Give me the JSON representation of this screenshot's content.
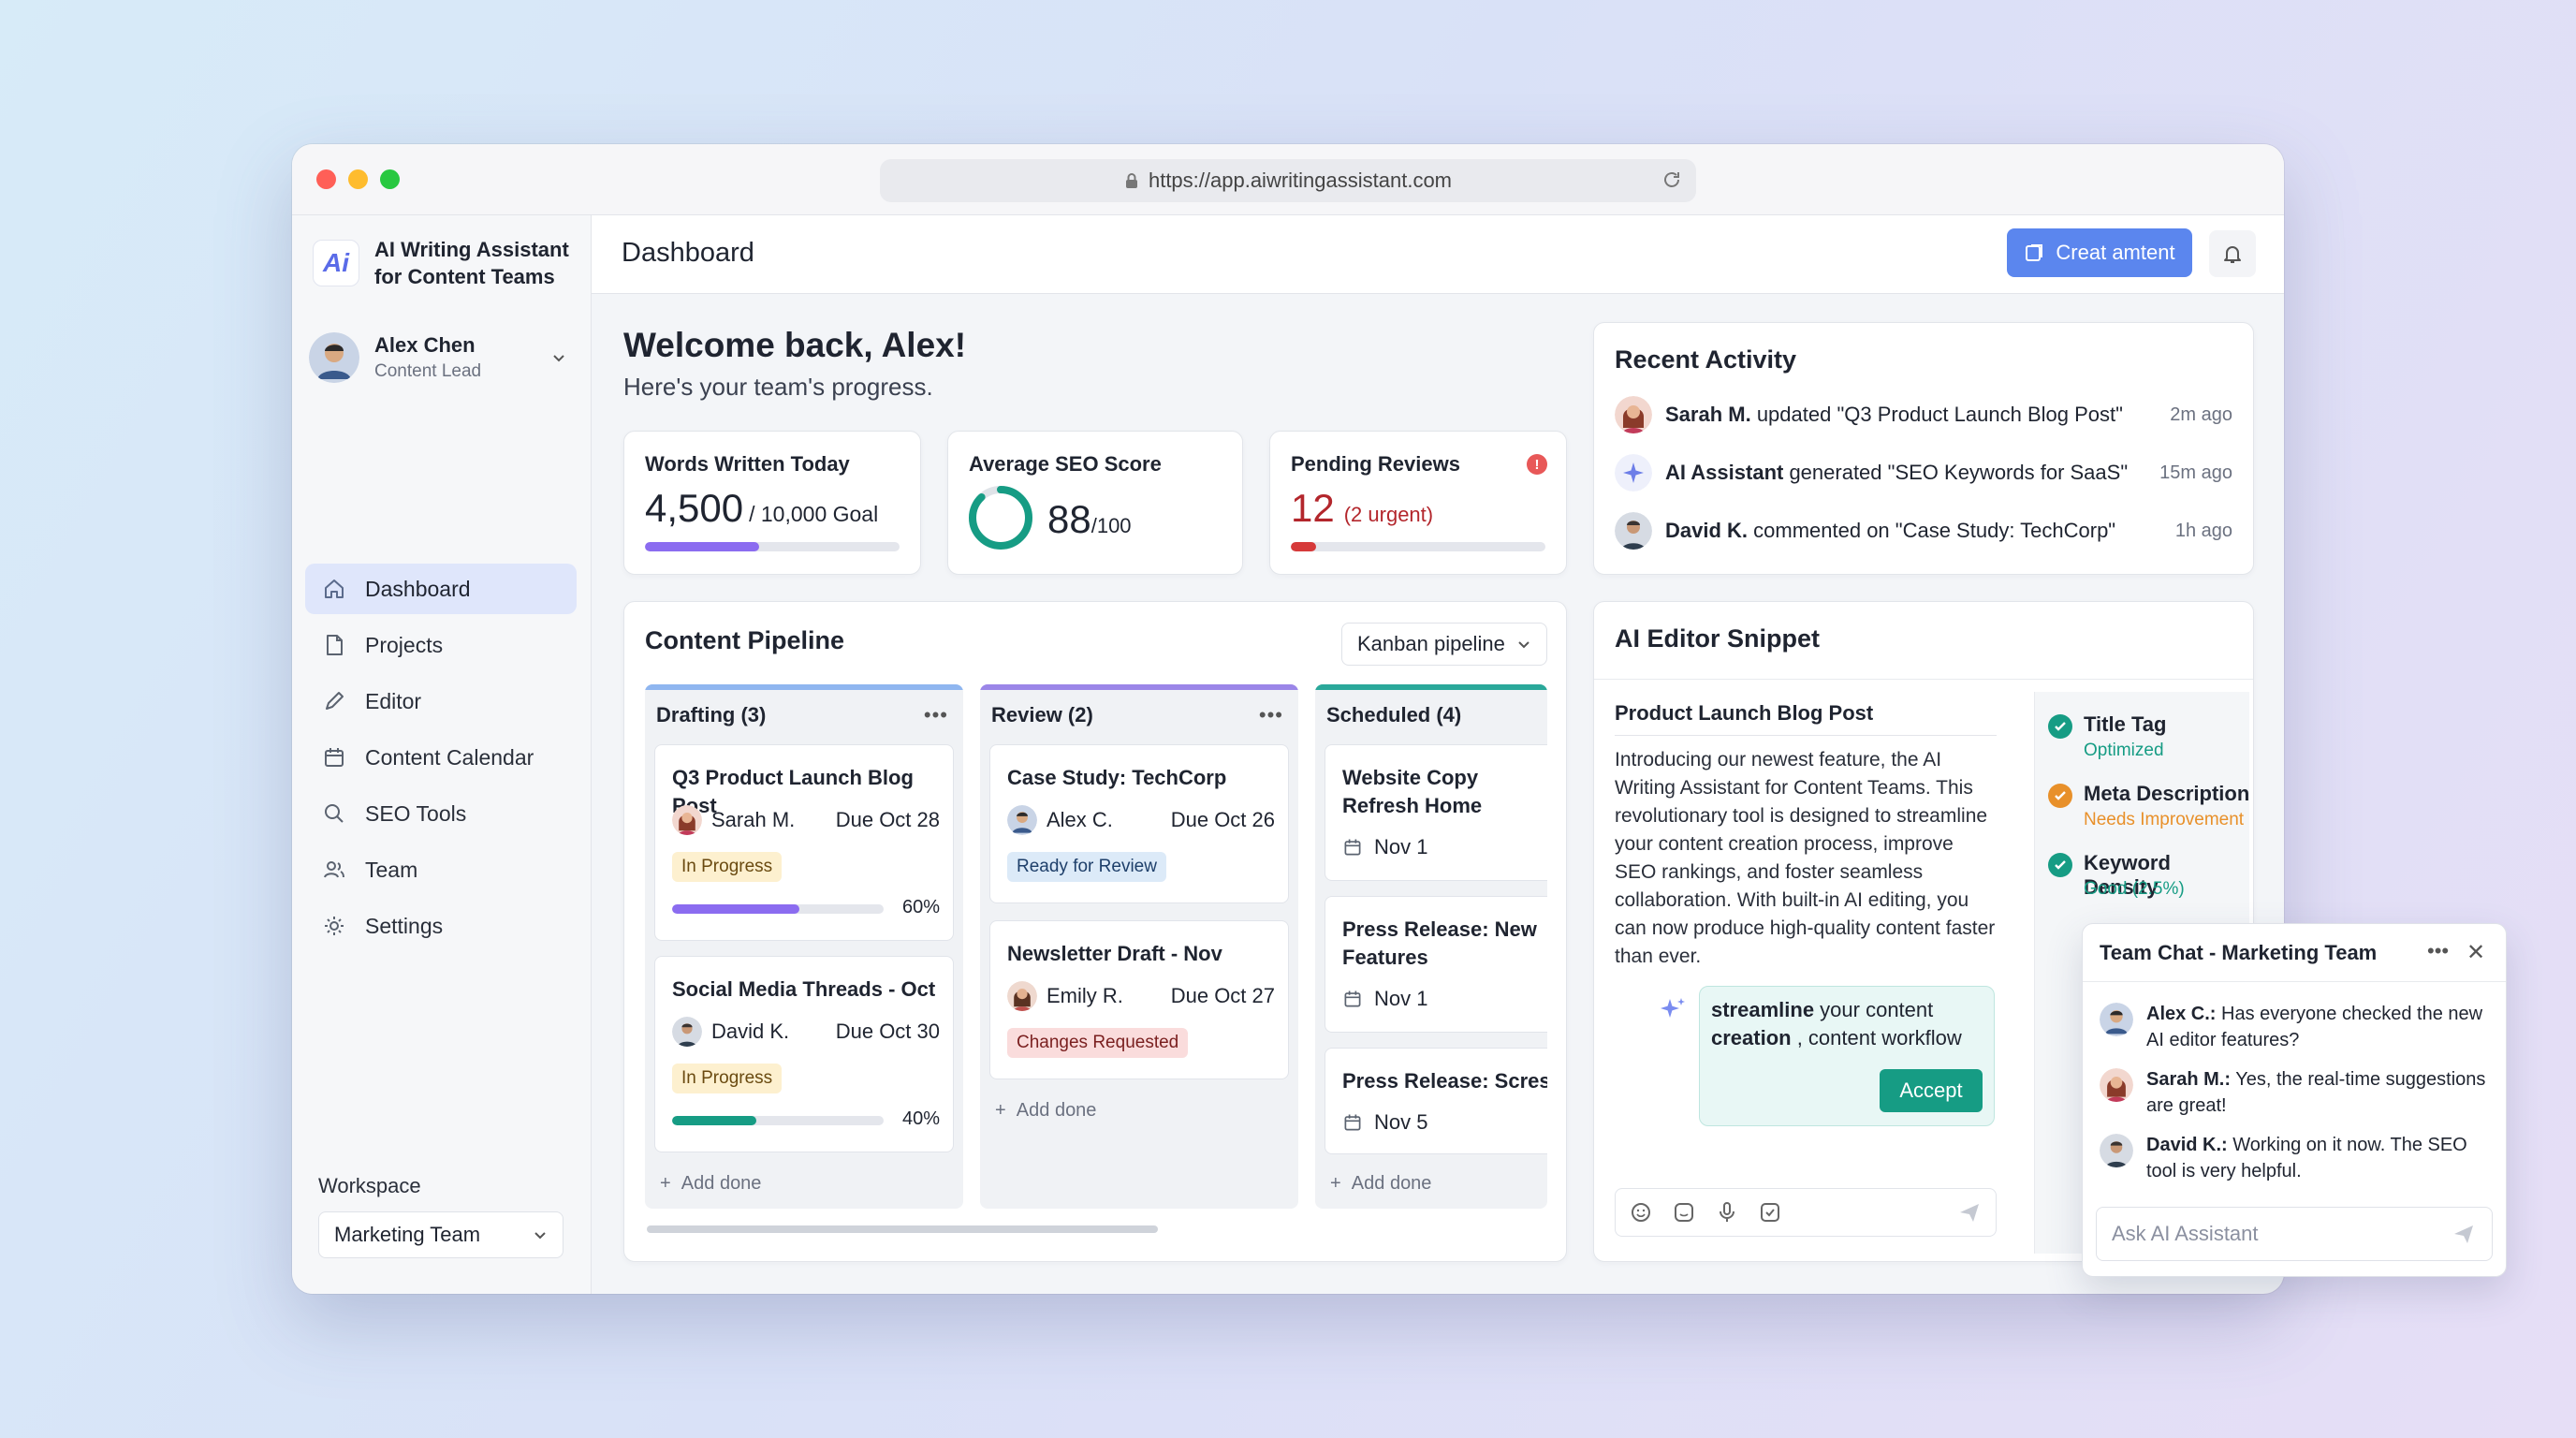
{
  "browser": {
    "url": "https://app.aiwritingassistant.com"
  },
  "brand": {
    "logo_text": "Ai",
    "name": "AI Writing Assistant for Content Teams"
  },
  "user": {
    "name": "Alex Chen",
    "role": "Content Lead"
  },
  "sidebar": {
    "items": [
      {
        "label": "Dashboard",
        "icon": "home-icon",
        "active": true
      },
      {
        "label": "Projects",
        "icon": "document-icon"
      },
      {
        "label": "Editor",
        "icon": "pencil-icon"
      },
      {
        "label": "Content Calendar",
        "icon": "calendar-icon"
      },
      {
        "label": "SEO Tools",
        "icon": "search-icon"
      },
      {
        "label": "Team",
        "icon": "users-icon"
      },
      {
        "label": "Settings",
        "icon": "gear-icon"
      }
    ],
    "workspace_label": "Workspace",
    "workspace_value": "Marketing Team"
  },
  "header": {
    "title": "Dashboard",
    "create_label": "Creat amtent"
  },
  "welcome": {
    "title": "Welcome back, Alex!",
    "subtitle": "Here's your team's progress."
  },
  "stats": {
    "words": {
      "label": "Words Written Today",
      "value": "4,500",
      "goal": "/ 10,000 Goal",
      "progress": 0.45,
      "color": "#8b6cf0"
    },
    "seo": {
      "label": "Average SEO Score",
      "value": "88",
      "max": "/100",
      "score": 0.88,
      "color": "#169c84"
    },
    "reviews": {
      "label": "Pending Reviews",
      "value": "12",
      "note": "(2 urgent)",
      "progress": 0.1,
      "color": "#d63a3a"
    }
  },
  "activity": {
    "title": "Recent Activity",
    "items": [
      {
        "who": "Sarah M.",
        "text": " updated \"Q3 Product Launch Blog Post\"",
        "time": "2m ago",
        "avatar": "sarah"
      },
      {
        "who": "AI Assistant",
        "text": " generated \"SEO Keywords for SaaS\"",
        "time": "15m ago",
        "avatar": "ai"
      },
      {
        "who": "David K.",
        "text": " commented on \"Case Study: TechCorp\"",
        "time": "1h ago",
        "avatar": "david"
      }
    ]
  },
  "pipeline": {
    "title": "Content Pipeline",
    "view": "Kanban pipeline",
    "columns": [
      {
        "title": "Drafting (3)",
        "color": "#8fb6f0",
        "tasks": [
          {
            "title": "Q3 Product Launch Blog Post",
            "person": "Sarah M.",
            "due": "Due Oct 28",
            "tag": "In Progress",
            "progress": "60%"
          },
          {
            "title": "Social Media Threads - Oct",
            "person": "David K.",
            "due": "Due Oct 30",
            "tag": "In Progress",
            "progress": "40%"
          }
        ],
        "add": "Add done"
      },
      {
        "title": "Review (2)",
        "color": "#9b86e8",
        "tasks": [
          {
            "title": "Case Study: TechCorp",
            "person": "Alex C.",
            "due": "Due Oct 26",
            "tag": "Ready for Review"
          },
          {
            "title": "Newsletter Draft - Nov",
            "person": "Emily R.",
            "due": "Due Oct 27",
            "tag": "Changes Requested"
          }
        ],
        "add": "Add done"
      },
      {
        "title": "Scheduled (4)",
        "color": "#2aa89a",
        "tasks": [
          {
            "title": "Website Copy Refresh Home",
            "date": "Nov 1"
          },
          {
            "title": "Press Release: New Features",
            "date": "Nov 1"
          },
          {
            "title": "Press Release: Scresw",
            "date": "Nov 5"
          }
        ],
        "add": "Add done"
      }
    ]
  },
  "editor": {
    "title": "AI Editor Snippet",
    "doc_title": "Product Launch Blog Post",
    "body": "Introducing our newest feature, the AI Writing Assistant for Content Teams. This revolutionary tool is designed to streamline your content creation process, improve SEO rankings, and foster seamless collaboration. With built-in AI editing, you can now produce high-quality content faster than ever.",
    "suggestion_strong": "streamline",
    "suggestion_mid": " your content ",
    "suggestion_strong2": "creation",
    "suggestion_end": " , content workflow",
    "accept_label": "Accept",
    "checks": [
      {
        "name": "Title Tag",
        "status": "Optimized",
        "color": "#169c84"
      },
      {
        "name": "Meta Description",
        "status": "Needs Improvement",
        "color": "#e8902a"
      },
      {
        "name": "Keyword Density",
        "status": "Good (2.5%)",
        "color": "#169c84"
      }
    ]
  },
  "chat": {
    "title": "Team Chat - Marketing Team",
    "messages": [
      {
        "who": "Alex C.:",
        "text": " Has everyone checked the new AI editor features?",
        "avatar": "alex"
      },
      {
        "who": "Sarah M.:",
        "text": " Yes, the real-time suggestions are great!",
        "avatar": "sarah"
      },
      {
        "who": "David K.:",
        "text": " Working on it now. The SEO tool is very helpful.",
        "avatar": "david"
      }
    ],
    "placeholder": "Ask AI Assistant"
  }
}
